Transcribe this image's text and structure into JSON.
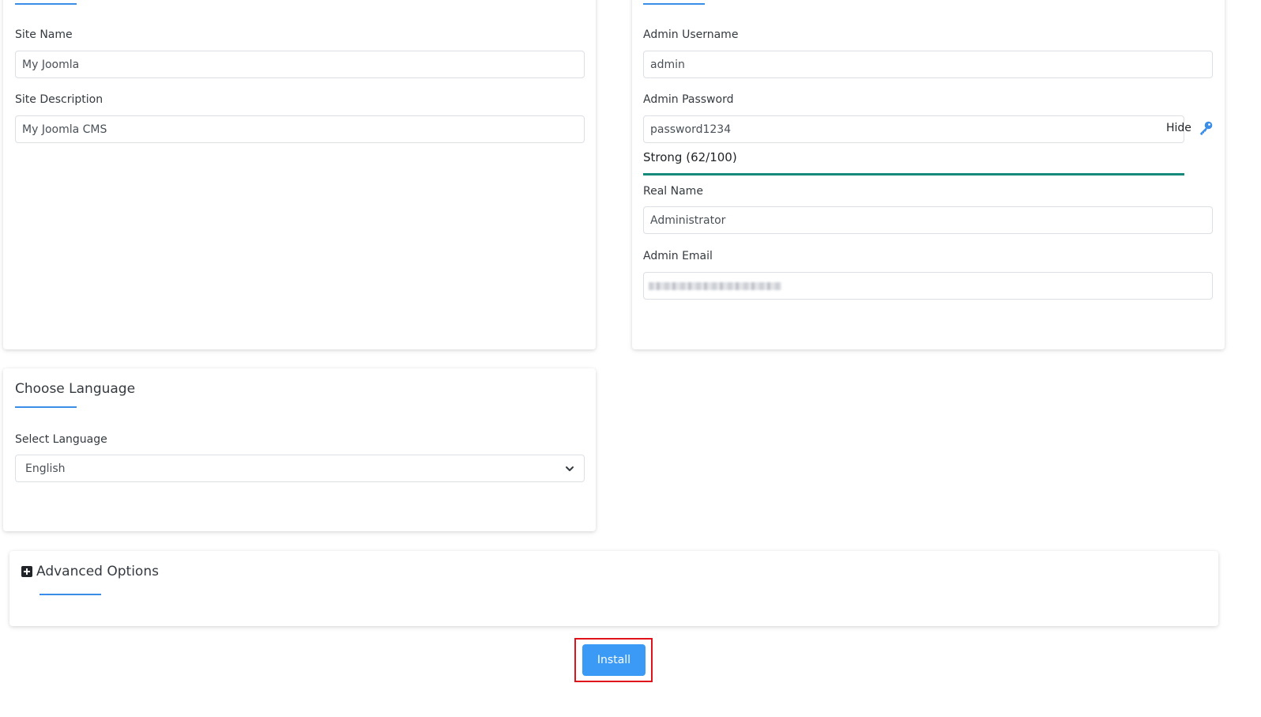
{
  "site": {
    "site_name_label": "Site Name",
    "site_name_value": "My Joomla",
    "site_description_label": "Site Description",
    "site_description_value": "My Joomla CMS"
  },
  "admin": {
    "username_label": "Admin Username",
    "username_value": "admin",
    "password_label": "Admin Password",
    "password_value": "password1234",
    "hide_label": "Hide",
    "strength_text": "Strong (62/100)",
    "strength_score": 62,
    "strength_color": "#168a7a",
    "real_name_label": "Real Name",
    "real_name_value": "Administrator",
    "email_label": "Admin Email"
  },
  "language": {
    "section_title": "Choose Language",
    "select_label": "Select Language",
    "selected_value": "English"
  },
  "advanced": {
    "title": "Advanced Options",
    "icon": "plus-square-icon"
  },
  "actions": {
    "install_label": "Install"
  },
  "colors": {
    "accent": "#3b8ee8",
    "button": "#3b9af5",
    "highlight": "#e0131a"
  }
}
